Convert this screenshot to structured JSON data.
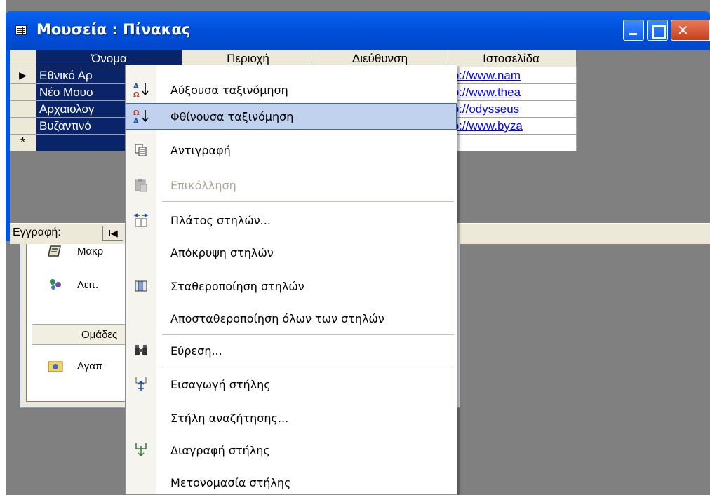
{
  "window": {
    "title": "Μουσεία : Πίνακας"
  },
  "table": {
    "columns": [
      "Όνομα",
      "Περιοχή",
      "Διεύθυνση",
      "Ιστοσελίδα"
    ],
    "rows": [
      {
        "name": "Εθνικό Αρ",
        "url": "tp://www.nam"
      },
      {
        "name": "Νέο Μουσ",
        "url": "tp://www.thea"
      },
      {
        "name": "Αρχαιολογ",
        "url": "tp://odysseus"
      },
      {
        "name": "Βυζαντινό",
        "url": "tp://www.byza"
      }
    ],
    "new_row_marker": "*",
    "current_row_marker": "▶"
  },
  "nav": {
    "label": "Εγγραφή:",
    "first_symbol": "I◀"
  },
  "db_window": {
    "objects": [
      {
        "label": "Μακρ",
        "icon": "macro-icon"
      },
      {
        "label": "Λειτ.",
        "icon": "module-icon"
      }
    ],
    "groups_header": "Ομάδες",
    "groups": [
      {
        "label": "Αγαπ",
        "icon": "favorites-folder-icon"
      }
    ]
  },
  "context_menu": {
    "items": [
      {
        "label": "Αύξουσα ταξινόμηση",
        "icon": "sort-ascending-icon",
        "highlighted": false,
        "disabled": false
      },
      {
        "label": "Φθίνουσα ταξινόμηση",
        "icon": "sort-descending-icon",
        "highlighted": true,
        "disabled": false
      },
      {
        "label": "Αντιγραφή",
        "icon": "copy-icon",
        "highlighted": false,
        "disabled": false
      },
      {
        "label": "Επικόλληση",
        "icon": "paste-icon",
        "highlighted": false,
        "disabled": true
      },
      {
        "label": "Πλάτος στηλών...",
        "icon": "column-width-icon",
        "highlighted": false,
        "disabled": false
      },
      {
        "label": "Απόκρυψη στηλών",
        "icon": "",
        "highlighted": false,
        "disabled": false
      },
      {
        "label": "Σταθεροποίηση στηλών",
        "icon": "freeze-columns-icon",
        "highlighted": false,
        "disabled": false
      },
      {
        "label": "Αποσταθεροποίηση όλων των στηλών",
        "icon": "",
        "highlighted": false,
        "disabled": false
      },
      {
        "label": "Εύρεση...",
        "icon": "binoculars-icon",
        "highlighted": false,
        "disabled": false
      },
      {
        "label": "Εισαγωγή στήλης",
        "icon": "insert-column-icon",
        "highlighted": false,
        "disabled": false
      },
      {
        "label": "Στήλη αναζήτησης...",
        "icon": "",
        "highlighted": false,
        "disabled": false
      },
      {
        "label": "Διαγραφή στήλης",
        "icon": "delete-column-icon",
        "highlighted": false,
        "disabled": false
      },
      {
        "label": "Μετονομασία στήλης",
        "icon": "",
        "highlighted": false,
        "disabled": false
      }
    ]
  },
  "colors": {
    "title_bar": "#0054E3",
    "menu_highlight": "#C1D2EE",
    "selected_column": "#0A246A",
    "link": "#0000FF"
  }
}
